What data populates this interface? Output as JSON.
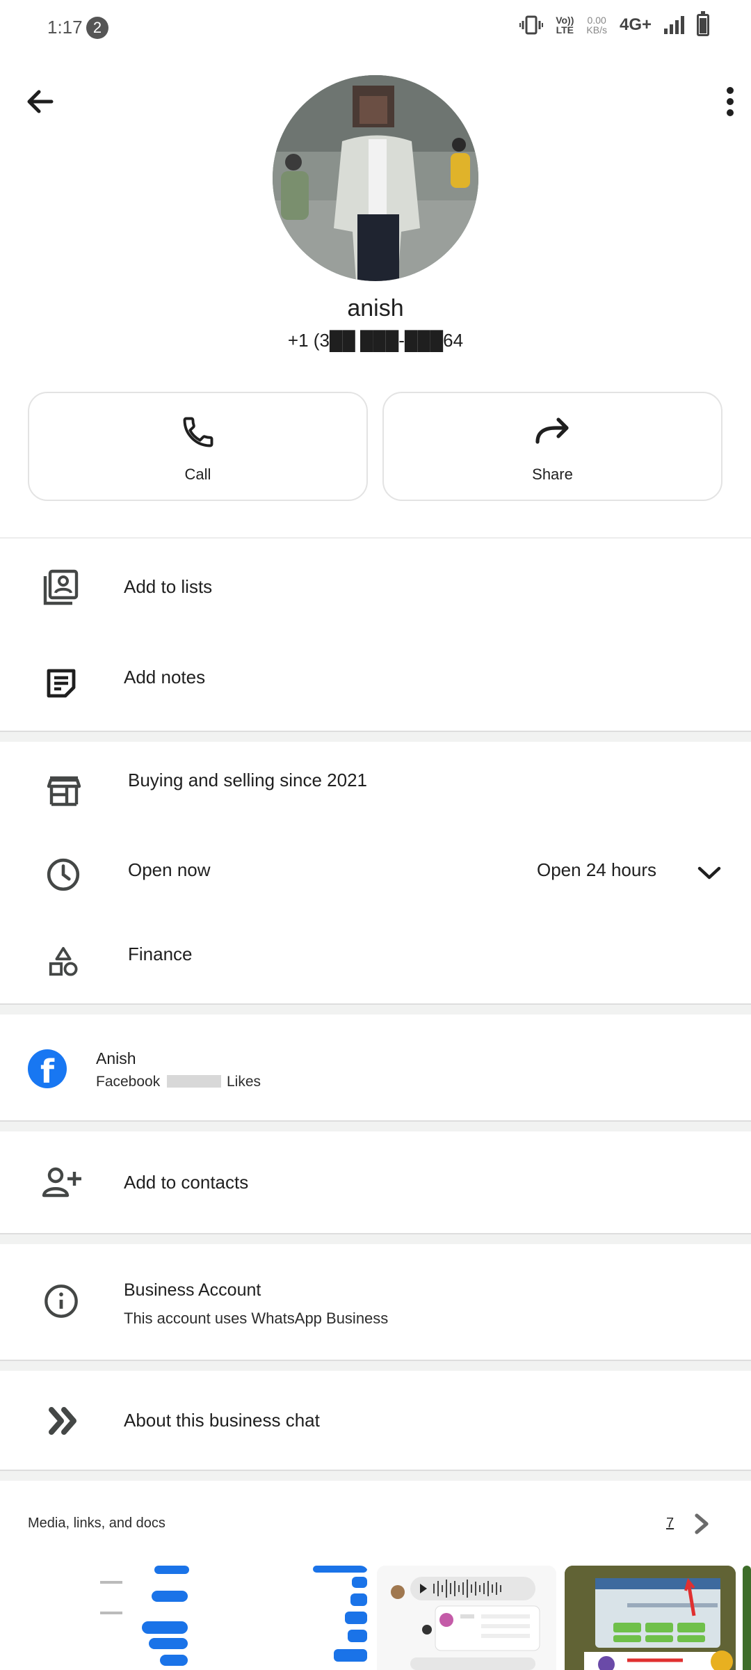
{
  "status_bar": {
    "time": "1:17",
    "notification_count": "2",
    "volte_line1": "Vo))",
    "volte_line2": "LTE",
    "speed_value": "0.00",
    "speed_unit": "KB/s",
    "network": "4G+"
  },
  "profile": {
    "name": "anish",
    "phone": "+1 (3██ ███-███64"
  },
  "actions": {
    "call_label": "Call",
    "share_label": "Share"
  },
  "list_section": {
    "add_to_lists": "Add to lists",
    "add_notes": "Add notes"
  },
  "business_info": {
    "description": "Buying and selling since 2021",
    "hours_status": "Open now",
    "hours_detail": "Open 24 hours",
    "category": "Finance"
  },
  "facebook": {
    "name": "Anish",
    "likes_prefix": "Facebook",
    "likes_suffix": "Likes"
  },
  "add_to_contacts": "Add to contacts",
  "business_account": {
    "title": "Business Account",
    "subtitle": "This account uses WhatsApp Business"
  },
  "about_business_chat": "About this business chat",
  "media": {
    "title": "Media, links, and docs",
    "count": "7"
  },
  "colors": {
    "accent_blue": "#1877f2",
    "icon_gray": "#444746",
    "chat_bubble": "#1a73e8"
  }
}
